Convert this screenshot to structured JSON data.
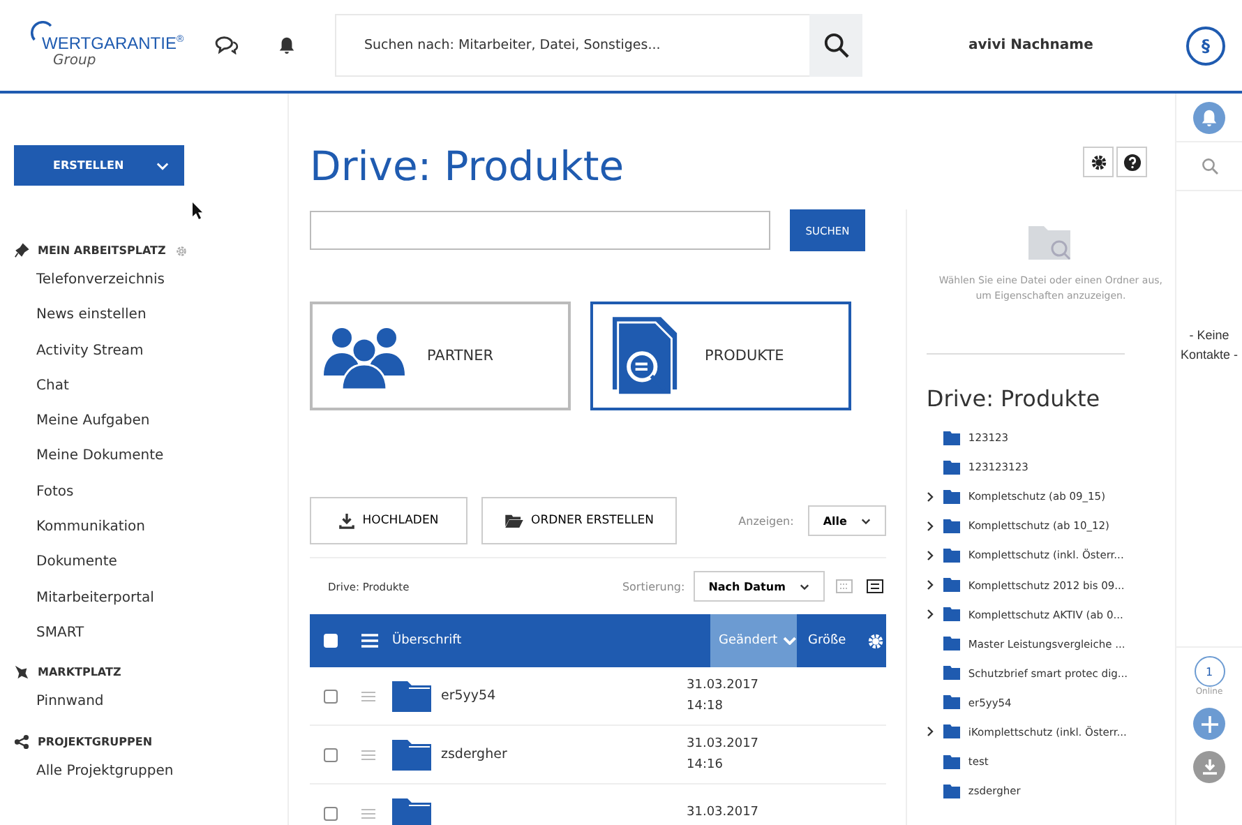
{
  "header": {
    "logo_text": "WERTGARANTIE",
    "logo_mark": "®",
    "logo_sub": "Group",
    "search_placeholder": "Suchen nach: Mitarbeiter, Datei, Sonstiges...",
    "user_name": "avivi Nachname",
    "badge": "§"
  },
  "sidebar": {
    "create_button": "ERSTELLEN",
    "sections": [
      {
        "title": "MEIN ARBEITSPLATZ",
        "has_settings": true,
        "items": [
          "Telefonverzeichnis",
          "News einstellen",
          "Activity Stream",
          "Chat",
          "Meine Aufgaben",
          "Meine Dokumente",
          "Fotos",
          "Kommunikation",
          "Dokumente",
          "Mitarbeiterportal",
          "SMART"
        ]
      },
      {
        "title": "MARKTPLATZ",
        "has_settings": false,
        "items": [
          "Pinnwand"
        ]
      },
      {
        "title": "PROJEKTGRUPPEN",
        "has_settings": false,
        "items": [
          "Alle Projektgruppen"
        ]
      }
    ]
  },
  "main": {
    "title": "Drive: Produkte",
    "search_button": "SUCHEN",
    "tiles": [
      {
        "label": "PARTNER",
        "selected": false
      },
      {
        "label": "PRODUKTE",
        "selected": true
      }
    ],
    "upload_button": "HOCHLADEN",
    "create_folder_button": "ORDNER ERSTELLEN",
    "show_label": "Anzeigen:",
    "show_value": "Alle",
    "breadcrumb": "Drive: Produkte",
    "sort_label": "Sortierung:",
    "sort_value": "Nach Datum",
    "view_modes": [
      {
        "selected": false
      },
      {
        "selected": true
      }
    ],
    "table": {
      "all_checked": false,
      "columns": [
        {
          "label": "Überschrift",
          "sorted": false
        },
        {
          "label": "Geändert",
          "sorted": true
        },
        {
          "label": "Größe",
          "sorted": false
        }
      ],
      "rows": [
        {
          "name": "er5yy54",
          "date": "31.03.2017",
          "time": "14:18",
          "checked": false
        },
        {
          "name": "zsdergher",
          "date": "31.03.2017",
          "time": "14:16",
          "checked": false
        },
        {
          "date": "31.03.2017",
          "checked": false
        }
      ]
    }
  },
  "details": {
    "hint": "Wählen Sie eine Datei oder einen Ordner aus,\num Eigenschaften anzuzeigen.",
    "tree_title": "Drive: Produkte",
    "tree": [
      {
        "label": "123123",
        "expandable": false
      },
      {
        "label": "123123123",
        "expandable": false
      },
      {
        "label": "Kompletschutz (ab 09_15)",
        "expandable": true
      },
      {
        "label": "Komplettschutz (ab 10_12)",
        "expandable": true
      },
      {
        "label": "Komplettschutz (inkl. Österr...",
        "expandable": true
      },
      {
        "label": "Komplettschutz 2012 bis 09...",
        "expandable": true
      },
      {
        "label": "Komplettschutz AKTIV (ab 0...",
        "expandable": true
      },
      {
        "label": "Master Leistungsvergleiche ...",
        "expandable": false
      },
      {
        "label": "Schutzbrief smart protec dig...",
        "expandable": false
      },
      {
        "label": "er5yy54",
        "expandable": false
      },
      {
        "label": "iKomplettschutz (inkl. Österr...",
        "expandable": true
      },
      {
        "label": "test",
        "expandable": false
      },
      {
        "label": "zsdergher",
        "expandable": false
      }
    ]
  },
  "contacts": {
    "empty_text": "- Keine Kontakte -",
    "online_count": "1",
    "online_label": "Online"
  }
}
